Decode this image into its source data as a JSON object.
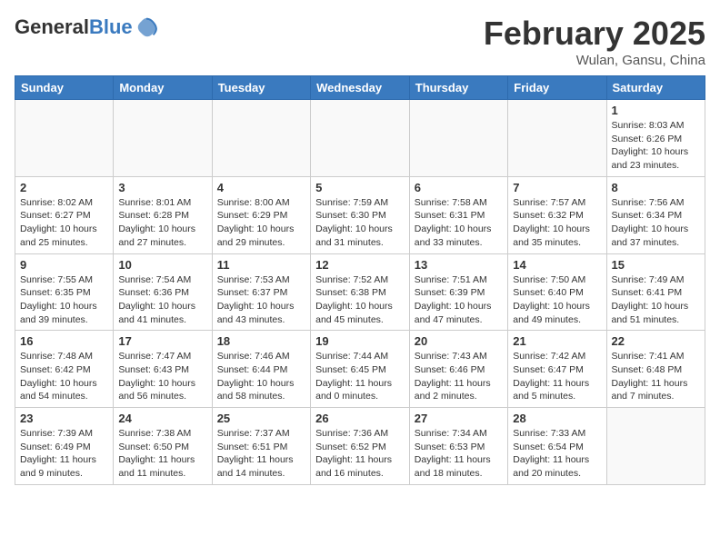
{
  "header": {
    "logo_general": "General",
    "logo_blue": "Blue",
    "month_title": "February 2025",
    "location": "Wulan, Gansu, China"
  },
  "days_of_week": [
    "Sunday",
    "Monday",
    "Tuesday",
    "Wednesday",
    "Thursday",
    "Friday",
    "Saturday"
  ],
  "weeks": [
    [
      {
        "day": "",
        "info": ""
      },
      {
        "day": "",
        "info": ""
      },
      {
        "day": "",
        "info": ""
      },
      {
        "day": "",
        "info": ""
      },
      {
        "day": "",
        "info": ""
      },
      {
        "day": "",
        "info": ""
      },
      {
        "day": "1",
        "info": "Sunrise: 8:03 AM\nSunset: 6:26 PM\nDaylight: 10 hours and 23 minutes."
      }
    ],
    [
      {
        "day": "2",
        "info": "Sunrise: 8:02 AM\nSunset: 6:27 PM\nDaylight: 10 hours and 25 minutes."
      },
      {
        "day": "3",
        "info": "Sunrise: 8:01 AM\nSunset: 6:28 PM\nDaylight: 10 hours and 27 minutes."
      },
      {
        "day": "4",
        "info": "Sunrise: 8:00 AM\nSunset: 6:29 PM\nDaylight: 10 hours and 29 minutes."
      },
      {
        "day": "5",
        "info": "Sunrise: 7:59 AM\nSunset: 6:30 PM\nDaylight: 10 hours and 31 minutes."
      },
      {
        "day": "6",
        "info": "Sunrise: 7:58 AM\nSunset: 6:31 PM\nDaylight: 10 hours and 33 minutes."
      },
      {
        "day": "7",
        "info": "Sunrise: 7:57 AM\nSunset: 6:32 PM\nDaylight: 10 hours and 35 minutes."
      },
      {
        "day": "8",
        "info": "Sunrise: 7:56 AM\nSunset: 6:34 PM\nDaylight: 10 hours and 37 minutes."
      }
    ],
    [
      {
        "day": "9",
        "info": "Sunrise: 7:55 AM\nSunset: 6:35 PM\nDaylight: 10 hours and 39 minutes."
      },
      {
        "day": "10",
        "info": "Sunrise: 7:54 AM\nSunset: 6:36 PM\nDaylight: 10 hours and 41 minutes."
      },
      {
        "day": "11",
        "info": "Sunrise: 7:53 AM\nSunset: 6:37 PM\nDaylight: 10 hours and 43 minutes."
      },
      {
        "day": "12",
        "info": "Sunrise: 7:52 AM\nSunset: 6:38 PM\nDaylight: 10 hours and 45 minutes."
      },
      {
        "day": "13",
        "info": "Sunrise: 7:51 AM\nSunset: 6:39 PM\nDaylight: 10 hours and 47 minutes."
      },
      {
        "day": "14",
        "info": "Sunrise: 7:50 AM\nSunset: 6:40 PM\nDaylight: 10 hours and 49 minutes."
      },
      {
        "day": "15",
        "info": "Sunrise: 7:49 AM\nSunset: 6:41 PM\nDaylight: 10 hours and 51 minutes."
      }
    ],
    [
      {
        "day": "16",
        "info": "Sunrise: 7:48 AM\nSunset: 6:42 PM\nDaylight: 10 hours and 54 minutes."
      },
      {
        "day": "17",
        "info": "Sunrise: 7:47 AM\nSunset: 6:43 PM\nDaylight: 10 hours and 56 minutes."
      },
      {
        "day": "18",
        "info": "Sunrise: 7:46 AM\nSunset: 6:44 PM\nDaylight: 10 hours and 58 minutes."
      },
      {
        "day": "19",
        "info": "Sunrise: 7:44 AM\nSunset: 6:45 PM\nDaylight: 11 hours and 0 minutes."
      },
      {
        "day": "20",
        "info": "Sunrise: 7:43 AM\nSunset: 6:46 PM\nDaylight: 11 hours and 2 minutes."
      },
      {
        "day": "21",
        "info": "Sunrise: 7:42 AM\nSunset: 6:47 PM\nDaylight: 11 hours and 5 minutes."
      },
      {
        "day": "22",
        "info": "Sunrise: 7:41 AM\nSunset: 6:48 PM\nDaylight: 11 hours and 7 minutes."
      }
    ],
    [
      {
        "day": "23",
        "info": "Sunrise: 7:39 AM\nSunset: 6:49 PM\nDaylight: 11 hours and 9 minutes."
      },
      {
        "day": "24",
        "info": "Sunrise: 7:38 AM\nSunset: 6:50 PM\nDaylight: 11 hours and 11 minutes."
      },
      {
        "day": "25",
        "info": "Sunrise: 7:37 AM\nSunset: 6:51 PM\nDaylight: 11 hours and 14 minutes."
      },
      {
        "day": "26",
        "info": "Sunrise: 7:36 AM\nSunset: 6:52 PM\nDaylight: 11 hours and 16 minutes."
      },
      {
        "day": "27",
        "info": "Sunrise: 7:34 AM\nSunset: 6:53 PM\nDaylight: 11 hours and 18 minutes."
      },
      {
        "day": "28",
        "info": "Sunrise: 7:33 AM\nSunset: 6:54 PM\nDaylight: 11 hours and 20 minutes."
      },
      {
        "day": "",
        "info": ""
      }
    ]
  ]
}
